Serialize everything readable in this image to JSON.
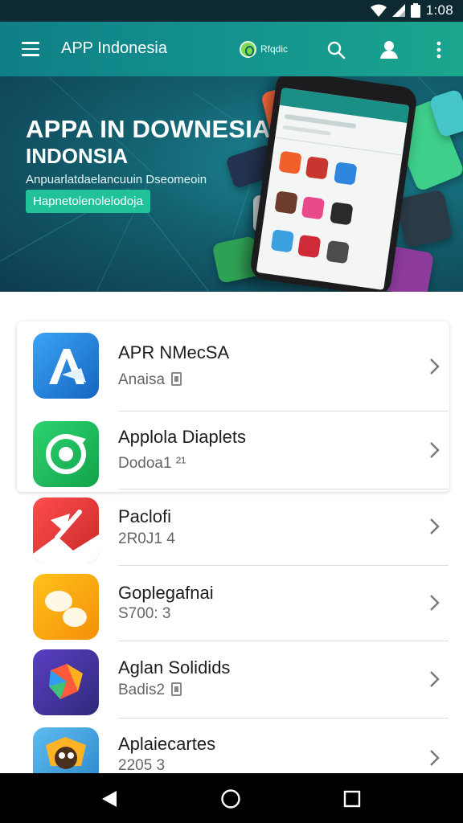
{
  "status_bar": {
    "time": "1:08",
    "icons": [
      "wifi-icon",
      "signal-icon",
      "battery-icon"
    ]
  },
  "app_bar": {
    "title": "APP Indonesia",
    "chip_label": "Rfqdic",
    "icons": [
      "menu-icon",
      "search-icon",
      "account-icon",
      "more-vert-icon"
    ],
    "color_start": "#0f7f86",
    "color_end": "#1aa68d"
  },
  "banner": {
    "headline": "APPA IN DOWNESIA",
    "headline2": "INDONSIA",
    "subtitle": "Anpuarlatdaelancuuin Dseomeoin",
    "cta_label": "Hapnetolenolelodoja",
    "accent": "#21c29a"
  },
  "apps": [
    {
      "name": "APR NMecSA",
      "meta": "Anaisa",
      "badge": true,
      "icon": "app-store-icon",
      "color": "#1e88e5"
    },
    {
      "name": "Applola Diaplets",
      "meta": "Dodoa1 ²¹",
      "badge": false,
      "icon": "refresh-icon",
      "color": "#1fb857"
    },
    {
      "name": "Paclofi",
      "meta": "2R0J1 4",
      "badge": false,
      "icon": "bookmark-icon",
      "color": "#e53935"
    },
    {
      "name": "Goplegafnai",
      "meta": "S700: 3",
      "badge": false,
      "icon": "chat-bubbles-icon",
      "color": "#fba71b"
    },
    {
      "name": "Aglan Solidids",
      "meta": "Badis2",
      "badge": true,
      "icon": "play-triangle-icon",
      "color": "#4a3da8"
    },
    {
      "name": "Aplaiecartes",
      "meta": "2205 3",
      "badge": false,
      "icon": "mascot-icon",
      "color": "#4fa7dd"
    }
  ],
  "nav_bar": {
    "icons": [
      "back-icon",
      "home-icon",
      "recents-icon"
    ]
  }
}
